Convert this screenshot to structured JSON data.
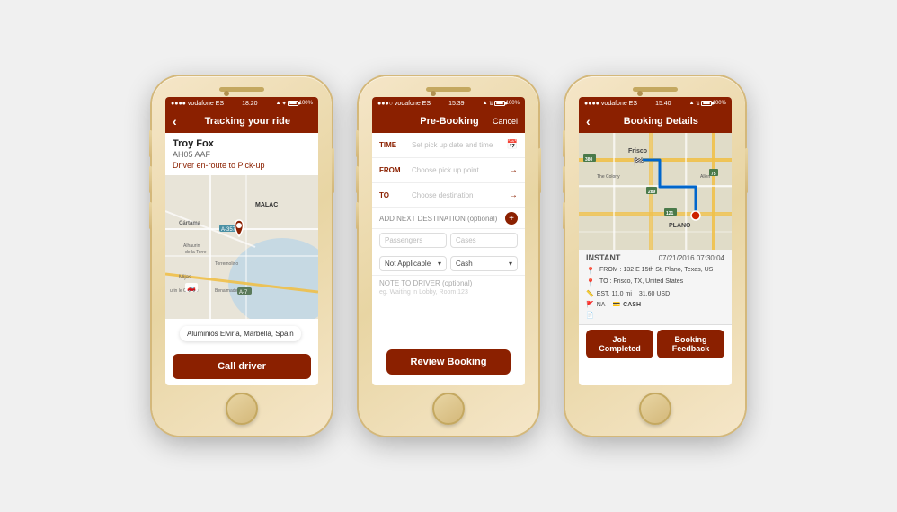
{
  "phone1": {
    "status": {
      "carrier": "vodafone ES",
      "time": "18:20",
      "battery": "100%"
    },
    "header": {
      "back": "‹",
      "title": "Tracking your ride"
    },
    "driver": {
      "name": "Troy Fox",
      "plate": "AH05 AAF",
      "status": "Driver en-route to Pick-up"
    },
    "location": "Aluminios Elviria, Marbella, Spain",
    "callBtn": "Call driver"
  },
  "phone2": {
    "status": {
      "carrier": "vodafone ES",
      "time": "15:39",
      "battery": "100%"
    },
    "header": {
      "title": "Pre-Booking",
      "cancel": "Cancel"
    },
    "form": {
      "timeLabel": "TIME",
      "timePlaceholder": "Set pick up date and time",
      "fromLabel": "FROM",
      "fromPlaceholder": "Choose pick up point",
      "toLabel": "TO",
      "toPlaceholder": "Choose destination",
      "addNextDest": "ADD NEXT DESTINATION (optional)",
      "passengersPlaceholder": "Passengers",
      "casesPlaceholder": "Cases",
      "notApplicable": "Not Applicable",
      "cash": "Cash",
      "noteLabel": "NOTE TO DRIVER (optional)",
      "notePlaceholder": "eg. Waiting in Lobby, Room 123"
    },
    "reviewBtn": "Review Booking"
  },
  "phone3": {
    "status": {
      "carrier": "vodafone ES",
      "time": "15:40",
      "battery": "100%"
    },
    "header": {
      "back": "‹",
      "title": "Booking Details"
    },
    "booking": {
      "type": "INSTANT",
      "datetime": "07/21/2016 07:30:04",
      "from": "FROM : 132 E 15th St, Plano, Texas, US",
      "to": "TO : Frisco, TX, United States",
      "est": "EST. 11.0 mi",
      "price": "31.60 USD",
      "na": "NA",
      "paymentMethod": "CASH"
    },
    "buttons": {
      "jobCompleted": "Job Completed",
      "bookingFeedback": "Booking Feedback"
    },
    "mapLabels": {
      "frisco": "Frisco",
      "plano": "PLANO",
      "colony": "The Colony",
      "allen": "Allen",
      "route380": "380",
      "route75": "75",
      "route121": "121",
      "route289": "289"
    }
  }
}
